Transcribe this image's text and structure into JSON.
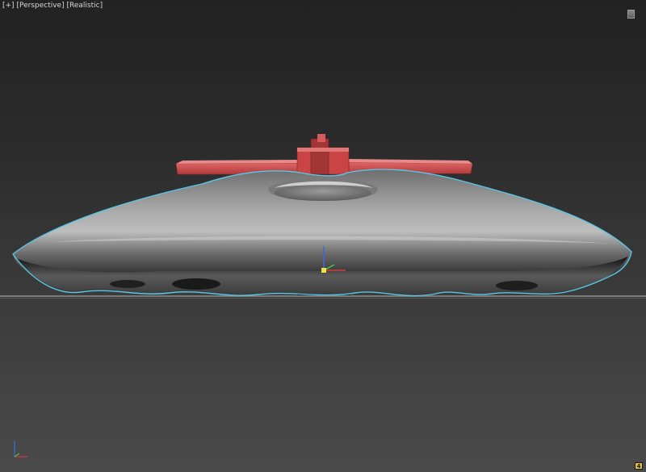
{
  "viewport": {
    "label_parts": [
      "[+]",
      "[Perspective]",
      "[Realistic]"
    ],
    "badge_text": "4"
  },
  "colors": {
    "selection_outline": "#58c7e6",
    "blade_red": "#d24a4a",
    "body_gray": "#9a9a9a",
    "axis_x": "#d83a3a",
    "axis_y": "#4ec54e",
    "axis_z": "#3b6be0"
  },
  "icons": [
    "viewcube-icon",
    "gizmo-icon",
    "world-axis-icon"
  ]
}
